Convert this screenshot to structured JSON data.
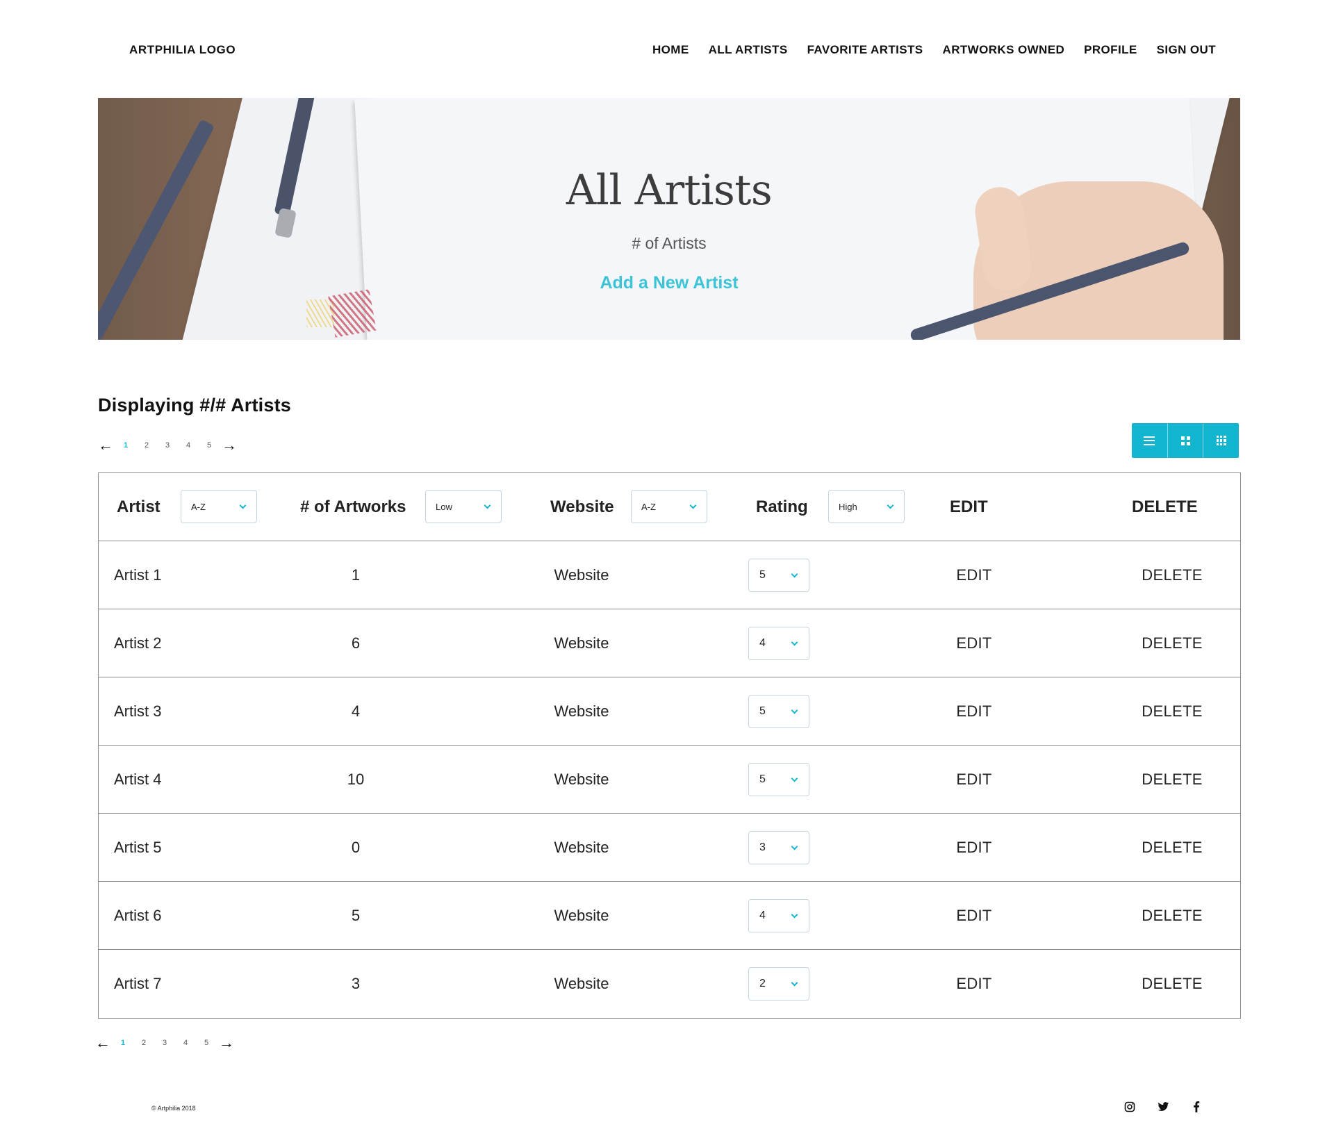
{
  "header": {
    "logo": "ARTPHILIA LOGO",
    "nav": [
      "HOME",
      "ALL ARTISTS",
      "FAVORITE ARTISTS",
      "ARTWORKS OWNED",
      "PROFILE",
      "SIGN OUT"
    ]
  },
  "hero": {
    "title": "All Artists",
    "subtitle": "# of Artists",
    "link": "Add a New Artist"
  },
  "listing": {
    "title": "Displaying #/# Artists",
    "pages": [
      "1",
      "2",
      "3",
      "4",
      "5"
    ],
    "active_page": "1"
  },
  "view_toggle": [
    "list-view-icon",
    "grid-view-icon",
    "compact-grid-icon"
  ],
  "table": {
    "headers": {
      "artist": "Artist",
      "artworks": "# of Artworks",
      "website": "Website",
      "rating": "Rating",
      "edit": "EDIT",
      "delete": "DELETE"
    },
    "sorts": {
      "artist": "A-Z",
      "artworks": "Low",
      "website": "A-Z",
      "rating": "High"
    },
    "rows": [
      {
        "artist": "Artist 1",
        "artworks": "1",
        "website": "Website",
        "rating": "5",
        "edit": "EDIT",
        "delete": "DELETE"
      },
      {
        "artist": "Artist 2",
        "artworks": "6",
        "website": "Website",
        "rating": "4",
        "edit": "EDIT",
        "delete": "DELETE"
      },
      {
        "artist": "Artist 3",
        "artworks": "4",
        "website": "Website",
        "rating": "5",
        "edit": "EDIT",
        "delete": "DELETE"
      },
      {
        "artist": "Artist 4",
        "artworks": "10",
        "website": "Website",
        "rating": "5",
        "edit": "EDIT",
        "delete": "DELETE"
      },
      {
        "artist": "Artist 5",
        "artworks": "0",
        "website": "Website",
        "rating": "3",
        "edit": "EDIT",
        "delete": "DELETE"
      },
      {
        "artist": "Artist 6",
        "artworks": "5",
        "website": "Website",
        "rating": "4",
        "edit": "EDIT",
        "delete": "DELETE"
      },
      {
        "artist": "Artist 7",
        "artworks": "3",
        "website": "Website",
        "rating": "2",
        "edit": "EDIT",
        "delete": "DELETE"
      }
    ]
  },
  "footer": {
    "copyright": "© Artphilia 2018",
    "social": [
      "instagram-icon",
      "twitter-icon",
      "facebook-icon"
    ]
  },
  "colors": {
    "accent": "#12b5cf",
    "link": "#3cc3d6",
    "text": "#222222",
    "border": "#8a8a8a"
  }
}
